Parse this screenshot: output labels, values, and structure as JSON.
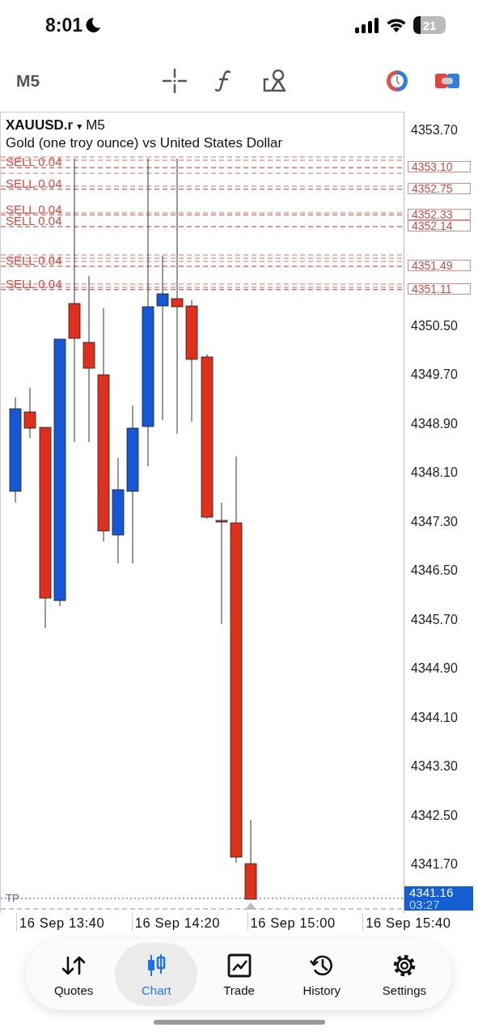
{
  "status_bar": {
    "time": "8:01",
    "battery": "21"
  },
  "toolbar": {
    "timeframe": "M5"
  },
  "chart": {
    "symbol": "XAUUSD.r",
    "dropdown": "▾",
    "timeframe": "M5",
    "description": "Gold (one troy ounce) vs United States Dollar",
    "price_ticks": [
      "4353.70",
      "4350.50",
      "4349.70",
      "4348.90",
      "4348.10",
      "4347.30",
      "4346.50",
      "4345.70",
      "4344.90",
      "4344.10",
      "4343.30",
      "4342.50",
      "4341.70"
    ],
    "orders": [
      {
        "label": "SELL 0.04",
        "price": "4353.10"
      },
      {
        "label": "SELL 0.04",
        "price": "4352.75"
      },
      {
        "label": "SELL 0.04",
        "price": "4352.33"
      },
      {
        "label": "SELL 0.04",
        "price": "4352.14"
      },
      {
        "label": "SELL 0.04",
        "price": "4351.49"
      },
      {
        "label": "SELL 0.04",
        "price": "4351.11"
      }
    ],
    "tp": {
      "label": "TP"
    },
    "current_price": {
      "price": "4341.16",
      "countdown": "03:27"
    },
    "time_ticks": [
      "16 Sep 13:40",
      "16 Sep 14:20",
      "16 Sep 15:00",
      "16 Sep 15:40"
    ]
  },
  "nav": [
    {
      "label": "Quotes",
      "kind": "quotes",
      "selected": false
    },
    {
      "label": "Chart",
      "kind": "chart",
      "selected": true
    },
    {
      "label": "Trade",
      "kind": "trade",
      "selected": false
    },
    {
      "label": "History",
      "kind": "history",
      "selected": false
    },
    {
      "label": "Settings",
      "kind": "settings",
      "selected": false
    }
  ]
}
